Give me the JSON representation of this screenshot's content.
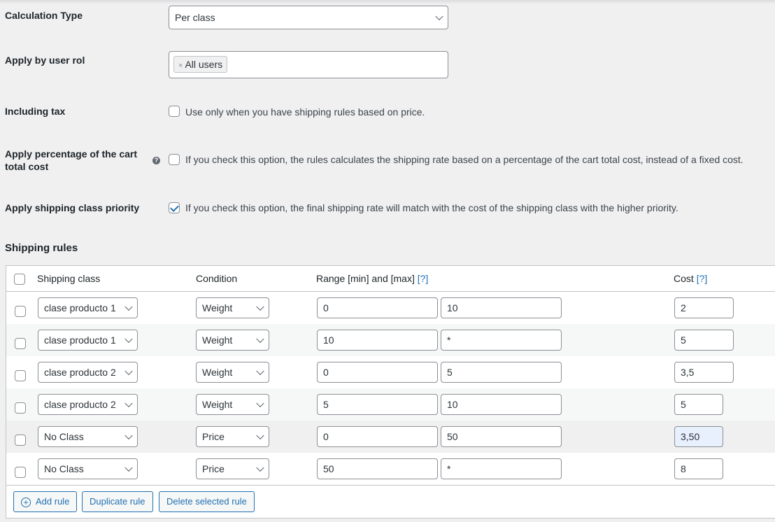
{
  "settings": {
    "calculation_type": {
      "label": "Calculation Type",
      "value": "Per class"
    },
    "user_role": {
      "label": "Apply by user rol",
      "tags": [
        {
          "text": "All users",
          "remove": "×"
        }
      ]
    },
    "including_tax": {
      "label": "Including tax",
      "description": "Use only when you have shipping rules based on price.",
      "checked": false
    },
    "percentage": {
      "label_line1": "Apply percentage of the cart",
      "label_line2": "total cost",
      "help": "?",
      "description": "If you check this option, the rules calculates the shipping rate based on a percentage of the cart total cost, instead of a fixed cost.",
      "checked": false
    },
    "class_priority": {
      "label": "Apply shipping class priority",
      "description": "If you check this option, the final shipping rate will match with the cost of the shipping class with the higher priority.",
      "checked": true
    }
  },
  "shipping_rules": {
    "title": "Shipping rules",
    "columns": {
      "shipping_class": "Shipping class",
      "condition": "Condition",
      "range": "Range [min] and [max]",
      "range_help": "[?]",
      "cost": "Cost",
      "cost_help": "[?]"
    },
    "rows": [
      {
        "shipping_class": "clase producto 1",
        "condition": "Weight",
        "min": "0",
        "max": "10",
        "cost": "2"
      },
      {
        "shipping_class": "clase producto 1",
        "condition": "Weight",
        "min": "10",
        "max": "*",
        "cost": "5"
      },
      {
        "shipping_class": "clase producto 2",
        "condition": "Weight",
        "min": "0",
        "max": "5",
        "cost": "3,5"
      },
      {
        "shipping_class": "clase producto 2",
        "condition": "Weight",
        "min": "5",
        "max": "10",
        "cost": "5"
      },
      {
        "shipping_class": "No Class",
        "condition": "Price",
        "min": "0",
        "max": "50",
        "cost": "3,50"
      },
      {
        "shipping_class": "No Class",
        "condition": "Price",
        "min": "50",
        "max": "*",
        "cost": "8"
      }
    ],
    "buttons": {
      "add": "Add rule",
      "add_icon": "⊕",
      "duplicate": "Duplicate rule",
      "delete": "Delete selected rule"
    }
  },
  "colors": {
    "accent": "#2271b1",
    "background": "#f0f0f1",
    "focus_field": "#e8f0fe"
  }
}
